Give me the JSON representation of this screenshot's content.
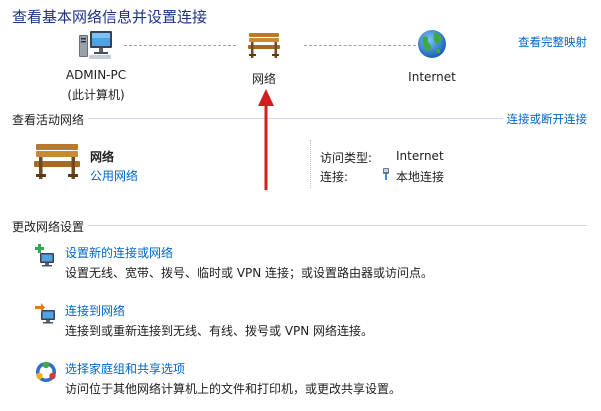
{
  "header": {
    "title": "查看基本网络信息并设置连接",
    "full_map_link": "查看完整映射"
  },
  "network_map": {
    "computer": {
      "name": "ADMIN-PC",
      "subtitle": "(此计算机)",
      "icon": "computer-icon"
    },
    "network": {
      "name": "网络",
      "icon": "bench-icon"
    },
    "internet": {
      "name": "Internet",
      "icon": "globe-icon"
    }
  },
  "active_networks": {
    "title": "查看活动网络",
    "connect_link": "连接或断开连接",
    "network_name": "网络",
    "network_type": "公用网络",
    "access_type_label": "访问类型:",
    "access_type_value": "Internet",
    "connection_label": "连接:",
    "connection_value": "本地连接"
  },
  "change_settings": {
    "title": "更改网络设置",
    "tasks": [
      {
        "icon": "new-connection-icon",
        "link": "设置新的连接或网络",
        "desc": "设置无线、宽带、拨号、临时或 VPN 连接；或设置路由器或访问点。"
      },
      {
        "icon": "connect-network-icon",
        "link": "连接到网络",
        "desc": "连接到或重新连接到无线、有线、拨号或 VPN 网络连接。"
      },
      {
        "icon": "homegroup-icon",
        "link": "选择家庭组和共享选项",
        "desc": "访问位于其他网络计算机上的文件和打印机，或更改共享设置。"
      }
    ]
  },
  "colors": {
    "title": "#1e3287",
    "link": "#0066cc",
    "annotation_arrow": "#d01f1f"
  }
}
